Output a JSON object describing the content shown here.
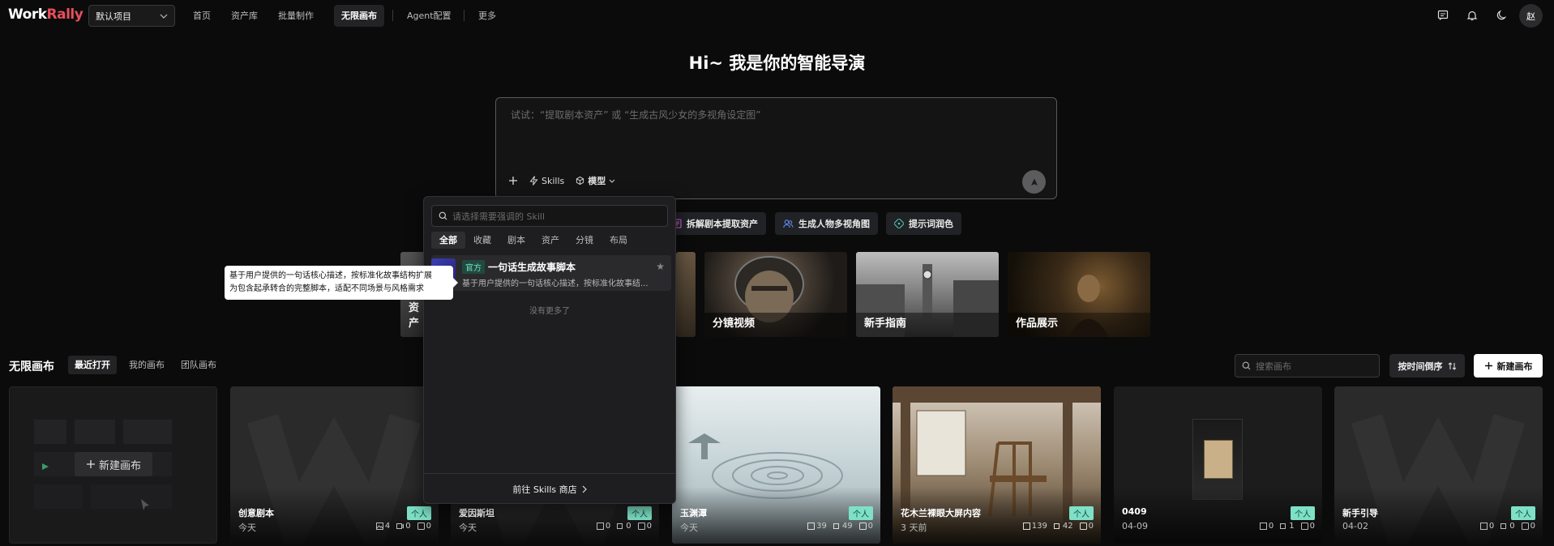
{
  "app": {
    "logo_main": "Work",
    "logo_accent": "Rally"
  },
  "project_select": {
    "value": "默认项目"
  },
  "nav": {
    "home": "首页",
    "assets": "资产库",
    "batch": "批量制作",
    "canvas": "无限画布",
    "agent": "Agent配置",
    "more": "更多"
  },
  "user": {
    "avatar_initial": "赵"
  },
  "hero": {
    "title": "Hi~ 我是你的智能导演"
  },
  "prompt": {
    "placeholder": "试试：“提取剧本资产” 或 “生成古风少女的多视角设定图”",
    "skills_label": "Skills",
    "model_label": "模型"
  },
  "quick_actions": [
    {
      "label": "拆解剧本提取资产",
      "color": "#d76ad9"
    },
    {
      "label": "生成人物多视角图",
      "color": "#5f8cf0"
    },
    {
      "label": "提示词润色",
      "color": "#4ec7b1"
    }
  ],
  "features": [
    {
      "label": "资产"
    },
    {
      "label": "分镜视频"
    },
    {
      "label": "新手指南"
    },
    {
      "label": "作品展示"
    }
  ],
  "section": {
    "title": "无限画布",
    "tabs": [
      "最近打开",
      "我的画布",
      "团队画布"
    ],
    "search_placeholder": "搜索画布",
    "sort_label": "按时间倒序",
    "new_label": "新建画布"
  },
  "new_card": {
    "label": "新建画布"
  },
  "cards": [
    {
      "name": "创意剧本",
      "date": "今天",
      "badge": "个人",
      "stats": [
        "4",
        "0",
        "0"
      ]
    },
    {
      "name": "爱因斯坦",
      "date": "今天",
      "badge": "个人",
      "stats": [
        "0",
        "0",
        "0"
      ]
    },
    {
      "name": "玉渊潭",
      "date": "今天",
      "badge": "个人",
      "stats": [
        "39",
        "49",
        "0"
      ]
    },
    {
      "name": "花木兰裸眼大屏内容",
      "date": "3 天前",
      "badge": "个人",
      "stats": [
        "139",
        "42",
        "0"
      ]
    },
    {
      "name": "0409",
      "date": "04-09",
      "badge": "个人",
      "stats": [
        "0",
        "1",
        "0"
      ]
    },
    {
      "name": "新手引导",
      "date": "04-02",
      "badge": "个人",
      "stats": [
        "0",
        "0",
        "0"
      ]
    }
  ],
  "popover": {
    "search_placeholder": "请选择需要强调的 Skill",
    "tabs": [
      "全部",
      "收藏",
      "剧本",
      "资产",
      "分镜",
      "布局"
    ],
    "skill": {
      "tag": "官方",
      "name": "一句话生成故事脚本",
      "desc": "基于用户提供的一句话核心描述，按标准化故事结..."
    },
    "empty": "没有更多了",
    "footer": "前往 Skills 商店"
  },
  "tooltip": {
    "line1": "基于用户提供的一句话核心描述，按标准化故事结构扩展",
    "line2": "为包含起承转合的完整脚本，适配不同场景与风格需求"
  }
}
